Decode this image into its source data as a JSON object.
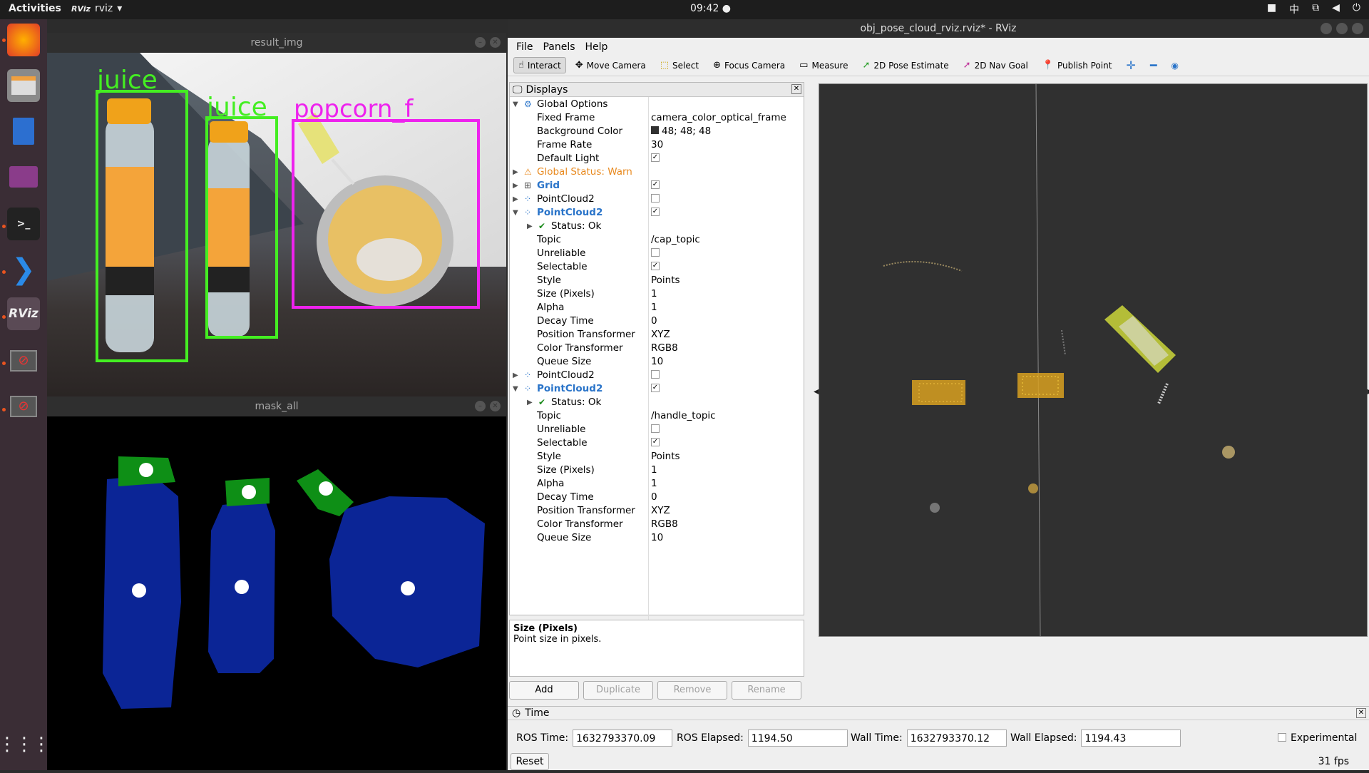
{
  "topbar": {
    "activities": "Activities",
    "app_name": "rviz",
    "app_icon_text": "RViz",
    "clock": "09:42",
    "input_method": "中"
  },
  "result_window": {
    "title": "result_img",
    "labels": [
      "juice",
      "juice",
      "popcorn_f"
    ]
  },
  "mask_window": {
    "title": "mask_all"
  },
  "rviz": {
    "title": "obj_pose_cloud_rviz.rviz* - RViz",
    "menu": [
      "File",
      "Panels",
      "Help"
    ],
    "tools": [
      "Interact",
      "Move Camera",
      "Select",
      "Focus Camera",
      "Measure",
      "2D Pose Estimate",
      "2D Nav Goal",
      "Publish Point"
    ],
    "displays_title": "Displays",
    "rows": [
      {
        "label": "Global Options",
        "value": ""
      },
      {
        "label": "Fixed Frame",
        "value": "camera_color_optical_frame"
      },
      {
        "label": "Background Color",
        "value": "48; 48; 48"
      },
      {
        "label": "Frame Rate",
        "value": "30"
      },
      {
        "label": "Default Light",
        "value": ""
      },
      {
        "label": "Global Status: Warn",
        "value": ""
      },
      {
        "label": "Grid",
        "value": ""
      },
      {
        "label": "PointCloud2",
        "value": ""
      },
      {
        "label": "PointCloud2",
        "value": ""
      },
      {
        "label": "Status: Ok",
        "value": ""
      },
      {
        "label": "Topic",
        "value": "/cap_topic"
      },
      {
        "label": "Unreliable",
        "value": ""
      },
      {
        "label": "Selectable",
        "value": ""
      },
      {
        "label": "Style",
        "value": "Points"
      },
      {
        "label": "Size (Pixels)",
        "value": "1"
      },
      {
        "label": "Alpha",
        "value": "1"
      },
      {
        "label": "Decay Time",
        "value": "0"
      },
      {
        "label": "Position Transformer",
        "value": "XYZ"
      },
      {
        "label": "Color Transformer",
        "value": "RGB8"
      },
      {
        "label": "Queue Size",
        "value": "10"
      },
      {
        "label": "PointCloud2",
        "value": ""
      },
      {
        "label": "PointCloud2",
        "value": ""
      },
      {
        "label": "Status: Ok",
        "value": ""
      },
      {
        "label": "Topic",
        "value": "/handle_topic"
      },
      {
        "label": "Unreliable",
        "value": ""
      },
      {
        "label": "Selectable",
        "value": ""
      },
      {
        "label": "Style",
        "value": "Points"
      },
      {
        "label": "Size (Pixels)",
        "value": "1"
      },
      {
        "label": "Alpha",
        "value": "1"
      },
      {
        "label": "Decay Time",
        "value": "0"
      },
      {
        "label": "Position Transformer",
        "value": "XYZ"
      },
      {
        "label": "Color Transformer",
        "value": "RGB8"
      },
      {
        "label": "Queue Size",
        "value": "10"
      }
    ],
    "desc_title": "Size (Pixels)",
    "desc_text": "Point size in pixels.",
    "buttons": {
      "add": "Add",
      "duplicate": "Duplicate",
      "remove": "Remove",
      "rename": "Rename"
    },
    "time": {
      "title": "Time",
      "ros_time_label": "ROS Time:",
      "ros_time": "1632793370.09",
      "ros_elapsed_label": "ROS Elapsed:",
      "ros_elapsed": "1194.50",
      "wall_time_label": "Wall Time:",
      "wall_time": "1632793370.12",
      "wall_elapsed_label": "Wall Elapsed:",
      "wall_elapsed": "1194.43",
      "experimental": "Experimental",
      "reset": "Reset",
      "fps": "31 fps"
    },
    "colors": {
      "background": "#303030",
      "juice_box": "#44ee22",
      "popcorn_box": "#ee22ee",
      "mask_body": "#0b2596",
      "mask_cap": "#0e8f16"
    }
  }
}
